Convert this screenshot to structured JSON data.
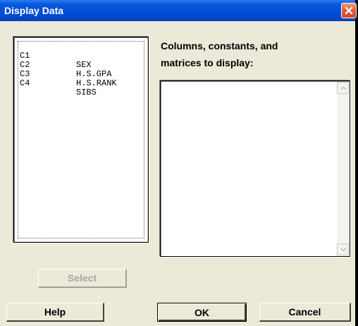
{
  "window": {
    "title": "Display Data"
  },
  "variables_list": {
    "items": [
      {
        "column": "C1",
        "name": "SEX"
      },
      {
        "column": "C2",
        "name": "H.S.GPA"
      },
      {
        "column": "C3",
        "name": "H.S.RANK"
      },
      {
        "column": "C4",
        "name": "SIBS"
      }
    ]
  },
  "display_field": {
    "label_line1": "Columns, constants, and",
    "label_line2": "matrices to display:",
    "value": ""
  },
  "buttons": {
    "select": "Select",
    "help": "Help",
    "ok": "OK",
    "cancel": "Cancel"
  },
  "icons": {
    "close": "close-icon",
    "scroll_up": "arrow-up-icon",
    "scroll_down": "arrow-down-icon"
  },
  "colors": {
    "titlebar": "#0050d8",
    "close": "#e2603a",
    "dialog_bg": "#ece9d8"
  }
}
